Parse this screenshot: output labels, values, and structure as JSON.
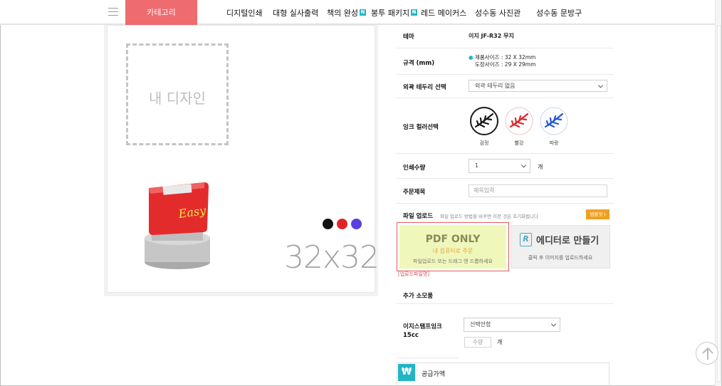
{
  "nav": {
    "category": "카테고리",
    "items": [
      {
        "label": "디지털인쇄",
        "new": false
      },
      {
        "label": "대형 실사출력",
        "new": false
      },
      {
        "label": "책의 완성",
        "new": true
      },
      {
        "label": "봉투 패키지",
        "new": true
      },
      {
        "label": "레드 메이커스",
        "new": false
      },
      {
        "label": "성수동 사진관",
        "new": false
      },
      {
        "label": "성수동 문방구",
        "new": false
      }
    ],
    "new_badge": "N"
  },
  "preview": {
    "design_placeholder": "내 디자인",
    "size_label": "32x32",
    "stamp_brand": "Easy",
    "ink_dots": [
      "#111111",
      "#e02424",
      "#5a3ee0"
    ]
  },
  "options": {
    "theme": {
      "label": "테마",
      "value": "이지 JF-R32 무지"
    },
    "spec": {
      "label": "규격 (mm)",
      "line1": "제품사이즈 : 32 X 32mm",
      "line2": "도장사이즈 : 29 X 29mm"
    },
    "border": {
      "label": "외곽 테두리 선택",
      "selected": "외곽 테두리 없음"
    },
    "ink": {
      "label": "잉크 컬러선택",
      "colors": [
        {
          "name": "검정",
          "color": "#1a1a1a"
        },
        {
          "name": "빨강",
          "color": "#e0242c"
        },
        {
          "name": "파랑",
          "color": "#2457d6"
        }
      ]
    },
    "quantity": {
      "label": "인쇄수량",
      "selected": "1",
      "unit": "개"
    },
    "order_title": {
      "label": "주문제목",
      "placeholder": "제목입력"
    },
    "upload": {
      "label": "파일 업로드",
      "note": "파일 업로드 방법을 바꾸면 이전 것은 초기화됩니다",
      "template_btn": "템플릿 ⭳",
      "pdf_title": "PDF ONLY",
      "pdf_sub": "내 컴퓨터로 주문",
      "pdf_hint": "파일업로드 또는 드래그 앤 드롭하세요",
      "editor_title": "에디터로 만들기",
      "editor_hint": "클릭 후 이미지를 업로드하세요",
      "filename": "[업로드파일명]"
    },
    "extras": {
      "label": "추가 소모품"
    },
    "ink_refill": {
      "label_line1": "이지스탬프잉크",
      "label_line2": "15cc",
      "selected": "선택안함",
      "qty_placeholder": "수량",
      "unit": "개"
    },
    "supply": {
      "icon": "₩",
      "label": "공급가액"
    }
  }
}
